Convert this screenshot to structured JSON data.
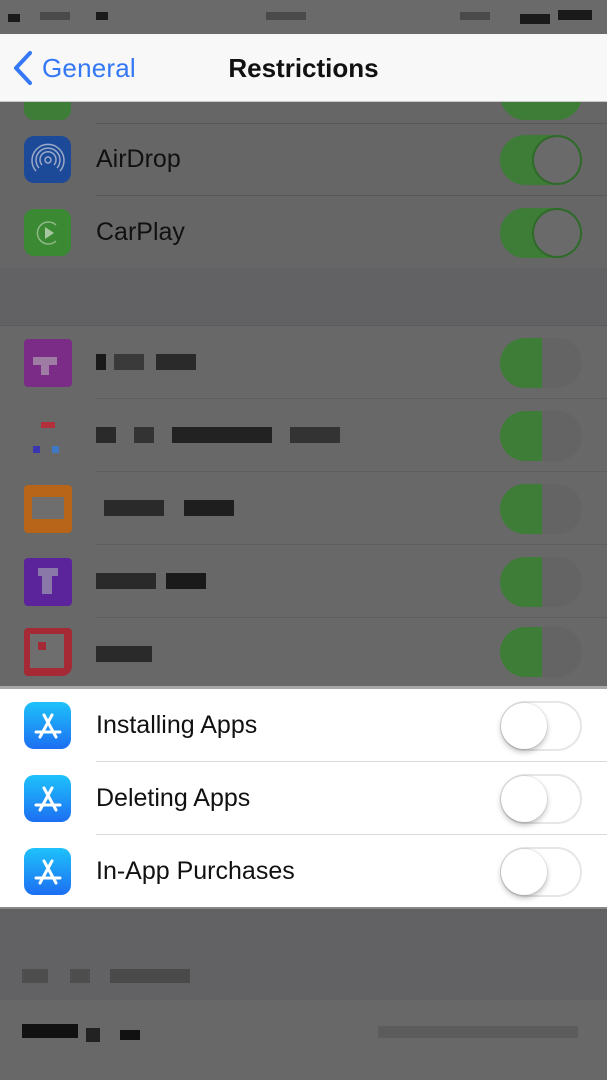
{
  "nav": {
    "back_label": "General",
    "title": "Restrictions"
  },
  "colors": {
    "accent": "#3478f6",
    "toggle_on": "#4cd964",
    "app_store_icon": "#1d7cf2",
    "airdrop_icon": "#1d4fa3",
    "carplay_icon": "#3b9e35"
  },
  "dimmed_rows": [
    {
      "label": "AirDrop",
      "icon": "airdrop-icon",
      "toggle": true
    },
    {
      "label": "CarPlay",
      "icon": "carplay-icon",
      "toggle": true
    }
  ],
  "blurred_rows": [
    {
      "label": "[obscured]",
      "toggle": true
    },
    {
      "label": "[obscured]",
      "toggle": true
    },
    {
      "label": "[obscured]",
      "toggle": true
    },
    {
      "label": "[obscured]",
      "toggle": true
    },
    {
      "label": "[obscured]",
      "toggle": true
    }
  ],
  "highlighted_rows": [
    {
      "label": "Installing Apps",
      "icon": "app-store-icon",
      "toggle": false
    },
    {
      "label": "Deleting Apps",
      "icon": "app-store-icon",
      "toggle": false
    },
    {
      "label": "In-App Purchases",
      "icon": "app-store-icon",
      "toggle": false
    }
  ]
}
